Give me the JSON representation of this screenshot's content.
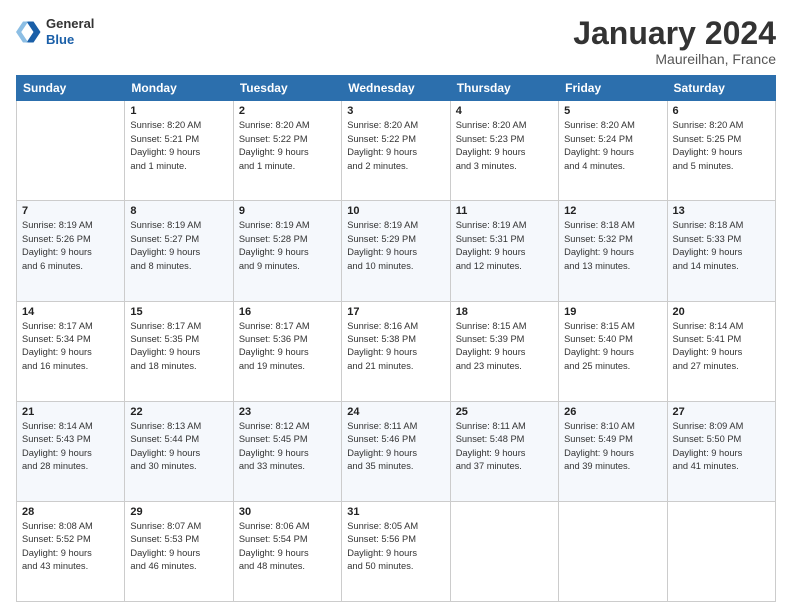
{
  "logo": {
    "general": "General",
    "blue": "Blue"
  },
  "title": "January 2024",
  "location": "Maureilhan, France",
  "weekdays": [
    "Sunday",
    "Monday",
    "Tuesday",
    "Wednesday",
    "Thursday",
    "Friday",
    "Saturday"
  ],
  "weeks": [
    [
      {
        "day": "",
        "info": ""
      },
      {
        "day": "1",
        "info": "Sunrise: 8:20 AM\nSunset: 5:21 PM\nDaylight: 9 hours\nand 1 minute."
      },
      {
        "day": "2",
        "info": "Sunrise: 8:20 AM\nSunset: 5:22 PM\nDaylight: 9 hours\nand 1 minute."
      },
      {
        "day": "3",
        "info": "Sunrise: 8:20 AM\nSunset: 5:22 PM\nDaylight: 9 hours\nand 2 minutes."
      },
      {
        "day": "4",
        "info": "Sunrise: 8:20 AM\nSunset: 5:23 PM\nDaylight: 9 hours\nand 3 minutes."
      },
      {
        "day": "5",
        "info": "Sunrise: 8:20 AM\nSunset: 5:24 PM\nDaylight: 9 hours\nand 4 minutes."
      },
      {
        "day": "6",
        "info": "Sunrise: 8:20 AM\nSunset: 5:25 PM\nDaylight: 9 hours\nand 5 minutes."
      }
    ],
    [
      {
        "day": "7",
        "info": "Sunrise: 8:19 AM\nSunset: 5:26 PM\nDaylight: 9 hours\nand 6 minutes."
      },
      {
        "day": "8",
        "info": "Sunrise: 8:19 AM\nSunset: 5:27 PM\nDaylight: 9 hours\nand 8 minutes."
      },
      {
        "day": "9",
        "info": "Sunrise: 8:19 AM\nSunset: 5:28 PM\nDaylight: 9 hours\nand 9 minutes."
      },
      {
        "day": "10",
        "info": "Sunrise: 8:19 AM\nSunset: 5:29 PM\nDaylight: 9 hours\nand 10 minutes."
      },
      {
        "day": "11",
        "info": "Sunrise: 8:19 AM\nSunset: 5:31 PM\nDaylight: 9 hours\nand 12 minutes."
      },
      {
        "day": "12",
        "info": "Sunrise: 8:18 AM\nSunset: 5:32 PM\nDaylight: 9 hours\nand 13 minutes."
      },
      {
        "day": "13",
        "info": "Sunrise: 8:18 AM\nSunset: 5:33 PM\nDaylight: 9 hours\nand 14 minutes."
      }
    ],
    [
      {
        "day": "14",
        "info": "Sunrise: 8:17 AM\nSunset: 5:34 PM\nDaylight: 9 hours\nand 16 minutes."
      },
      {
        "day": "15",
        "info": "Sunrise: 8:17 AM\nSunset: 5:35 PM\nDaylight: 9 hours\nand 18 minutes."
      },
      {
        "day": "16",
        "info": "Sunrise: 8:17 AM\nSunset: 5:36 PM\nDaylight: 9 hours\nand 19 minutes."
      },
      {
        "day": "17",
        "info": "Sunrise: 8:16 AM\nSunset: 5:38 PM\nDaylight: 9 hours\nand 21 minutes."
      },
      {
        "day": "18",
        "info": "Sunrise: 8:15 AM\nSunset: 5:39 PM\nDaylight: 9 hours\nand 23 minutes."
      },
      {
        "day": "19",
        "info": "Sunrise: 8:15 AM\nSunset: 5:40 PM\nDaylight: 9 hours\nand 25 minutes."
      },
      {
        "day": "20",
        "info": "Sunrise: 8:14 AM\nSunset: 5:41 PM\nDaylight: 9 hours\nand 27 minutes."
      }
    ],
    [
      {
        "day": "21",
        "info": "Sunrise: 8:14 AM\nSunset: 5:43 PM\nDaylight: 9 hours\nand 28 minutes."
      },
      {
        "day": "22",
        "info": "Sunrise: 8:13 AM\nSunset: 5:44 PM\nDaylight: 9 hours\nand 30 minutes."
      },
      {
        "day": "23",
        "info": "Sunrise: 8:12 AM\nSunset: 5:45 PM\nDaylight: 9 hours\nand 33 minutes."
      },
      {
        "day": "24",
        "info": "Sunrise: 8:11 AM\nSunset: 5:46 PM\nDaylight: 9 hours\nand 35 minutes."
      },
      {
        "day": "25",
        "info": "Sunrise: 8:11 AM\nSunset: 5:48 PM\nDaylight: 9 hours\nand 37 minutes."
      },
      {
        "day": "26",
        "info": "Sunrise: 8:10 AM\nSunset: 5:49 PM\nDaylight: 9 hours\nand 39 minutes."
      },
      {
        "day": "27",
        "info": "Sunrise: 8:09 AM\nSunset: 5:50 PM\nDaylight: 9 hours\nand 41 minutes."
      }
    ],
    [
      {
        "day": "28",
        "info": "Sunrise: 8:08 AM\nSunset: 5:52 PM\nDaylight: 9 hours\nand 43 minutes."
      },
      {
        "day": "29",
        "info": "Sunrise: 8:07 AM\nSunset: 5:53 PM\nDaylight: 9 hours\nand 46 minutes."
      },
      {
        "day": "30",
        "info": "Sunrise: 8:06 AM\nSunset: 5:54 PM\nDaylight: 9 hours\nand 48 minutes."
      },
      {
        "day": "31",
        "info": "Sunrise: 8:05 AM\nSunset: 5:56 PM\nDaylight: 9 hours\nand 50 minutes."
      },
      {
        "day": "",
        "info": ""
      },
      {
        "day": "",
        "info": ""
      },
      {
        "day": "",
        "info": ""
      }
    ]
  ]
}
